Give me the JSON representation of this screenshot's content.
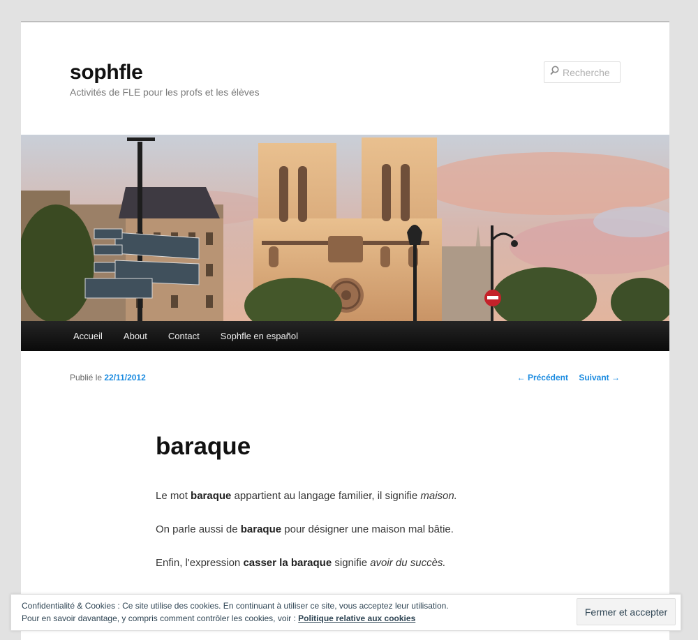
{
  "site": {
    "title": "sophfle",
    "description": "Activités de FLE pour les profs et les élèves"
  },
  "search": {
    "placeholder": "Recherche"
  },
  "nav": {
    "items": [
      "Accueil",
      "About",
      "Contact",
      "Sophfle en español"
    ]
  },
  "post_meta": {
    "published_prefix": "Publié le",
    "date": "22/11/2012",
    "previous": "← Précédent",
    "next": "Suivant →"
  },
  "post": {
    "title": "baraque",
    "p1": {
      "a": "Le mot ",
      "b": "baraque",
      "c": " appartient au langage familier, il signifie ",
      "i": "maison."
    },
    "p2": {
      "a": "On parle aussi de ",
      "b": "baraque",
      "c": " pour désigner une maison mal bâtie."
    },
    "p3": {
      "a": "Enfin, l'expression ",
      "b": "casser la baraque",
      "c": " signifie ",
      "i": "avoir du succès."
    }
  },
  "cookie": {
    "line1": "Confidentialité & Cookies : Ce site utilise des cookies. En continuant à utiliser ce site, vous acceptez leur utilisation.",
    "line2": "Pour en savoir davantage, y compris comment contrôler les cookies, voir : ",
    "link": "Politique relative aux cookies",
    "button": "Fermer et accepter"
  },
  "colors": {
    "link": "#1b8be0",
    "nav_bg": "#111111",
    "page_bg": "#e2e2e2"
  },
  "icons": {
    "search": "search-icon"
  }
}
